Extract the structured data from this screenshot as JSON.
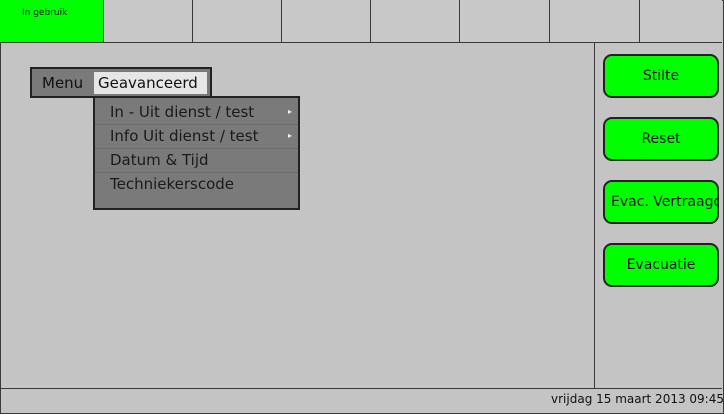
{
  "tabs": {
    "active_label": "In gebruik"
  },
  "menu": {
    "label": "Menu",
    "selected": "Geavanceerd",
    "items": [
      {
        "label": "In - Uit dienst / test",
        "submenu": true
      },
      {
        "label": "Info Uit dienst / test",
        "submenu": true
      },
      {
        "label": "Datum & Tijd",
        "submenu": false
      },
      {
        "label": "Techniekerscode",
        "submenu": false
      }
    ],
    "submenu_arrow": "▸"
  },
  "buttons": {
    "stilte": "Stilte",
    "reset": "Reset",
    "evac_vertraagd": "Evac. Vertraagd",
    "evacuatie": "Evacuatie"
  },
  "status": {
    "datetime": "vrijdag 15 maart 2013 09:45"
  },
  "colors": {
    "active": "#00ff00",
    "background": "#c4c4c4",
    "menu": "#7a7a7a"
  }
}
